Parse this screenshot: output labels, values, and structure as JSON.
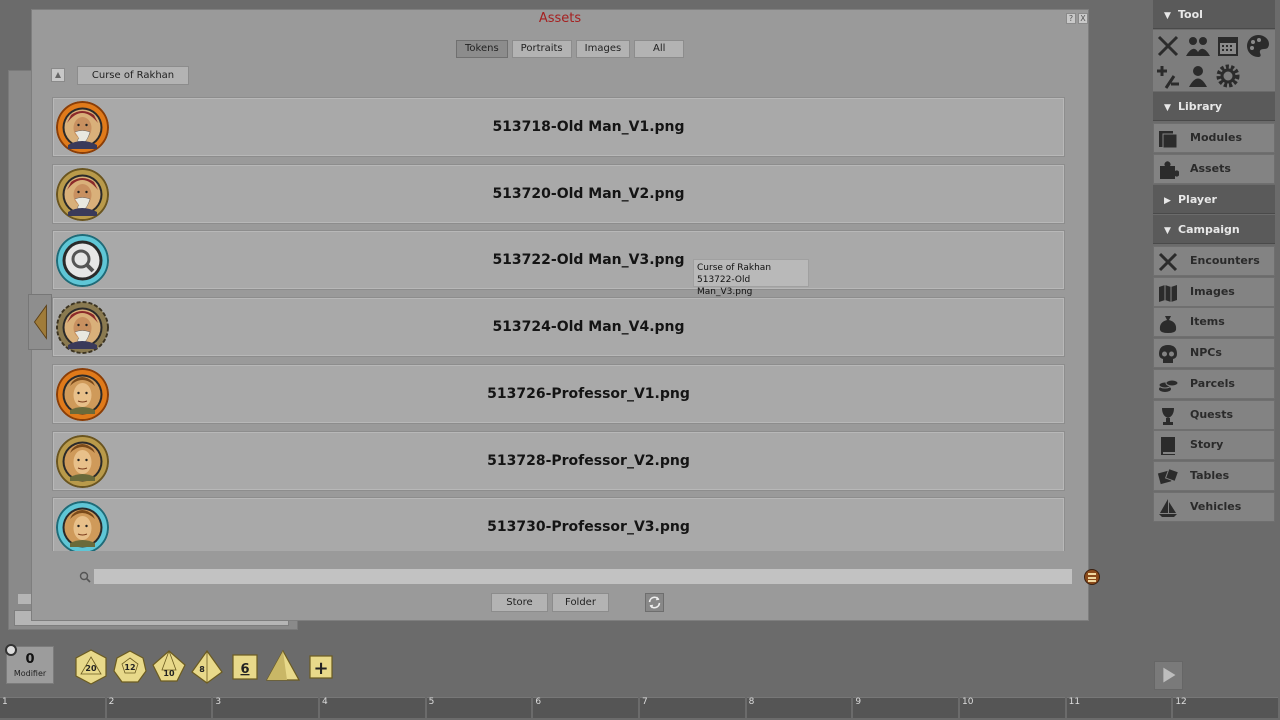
{
  "modal": {
    "title": "Assets",
    "help_btn": "?",
    "close_btn": "X",
    "tabs": [
      {
        "label": "Tokens",
        "active": true
      },
      {
        "label": "Portraits",
        "active": false
      },
      {
        "label": "Images",
        "active": false
      },
      {
        "label": "All",
        "active": false
      }
    ],
    "folder_label": "Curse of Rakhan",
    "assets": [
      {
        "name": "513718-Old Man_V1.png",
        "ring": "orange",
        "icon": "old-man-token"
      },
      {
        "name": "513720-Old Man_V2.png",
        "ring": "gold",
        "icon": "old-man-token"
      },
      {
        "name": "513722-Old Man_V3.png",
        "ring": "teal",
        "icon": "magnifier-token"
      },
      {
        "name": "513724-Old Man_V4.png",
        "ring": "gear",
        "icon": "old-man-token"
      },
      {
        "name": "513726-Professor_V1.png",
        "ring": "orange",
        "icon": "professor-token"
      },
      {
        "name": "513728-Professor_V2.png",
        "ring": "gold",
        "icon": "professor-token"
      },
      {
        "name": "513730-Professor_V3.png",
        "ring": "teal",
        "icon": "professor-token"
      }
    ],
    "tooltip": {
      "line1": "Curse of Rakhan",
      "line2": "513722-Old Man_V3.png"
    },
    "search": {
      "value": "",
      "placeholder": ""
    },
    "store_label": "Store",
    "folder_btn_label": "Folder"
  },
  "sidebar": {
    "tool_header": "Tool",
    "tool_icons": [
      "crossed-swords-icon",
      "party-icon",
      "calendar-icon",
      "palette-icon",
      "plus-minus-icon",
      "character-icon",
      "gear-icon"
    ],
    "library_header": "Library",
    "library_items": [
      {
        "label": "Modules",
        "icon": "modules-icon"
      },
      {
        "label": "Assets",
        "icon": "puzzle-icon"
      }
    ],
    "player_header": "Player",
    "campaign_header": "Campaign",
    "campaign_items": [
      {
        "label": "Encounters",
        "icon": "crossed-swords-icon"
      },
      {
        "label": "Images",
        "icon": "map-icon"
      },
      {
        "label": "Items",
        "icon": "bag-icon"
      },
      {
        "label": "NPCs",
        "icon": "skull-icon"
      },
      {
        "label": "Parcels",
        "icon": "coins-icon"
      },
      {
        "label": "Quests",
        "icon": "trophy-icon"
      },
      {
        "label": "Story",
        "icon": "book-icon"
      },
      {
        "label": "Tables",
        "icon": "dice-icon"
      },
      {
        "label": "Vehicles",
        "icon": "ship-icon"
      }
    ]
  },
  "dice_bar": {
    "modifier_value": "0",
    "modifier_label": "Modifier",
    "dice": [
      "20",
      "12",
      "10",
      "8",
      "6",
      ""
    ],
    "add_label": "+"
  },
  "hotbar": {
    "slots": [
      "1",
      "2",
      "3",
      "4",
      "5",
      "6",
      "7",
      "8",
      "9",
      "10",
      "11",
      "12"
    ]
  },
  "colors": {
    "title_red": "#a52020",
    "sidebar_header": "#5a5a5a",
    "die_yellow": "#e8d98a"
  }
}
